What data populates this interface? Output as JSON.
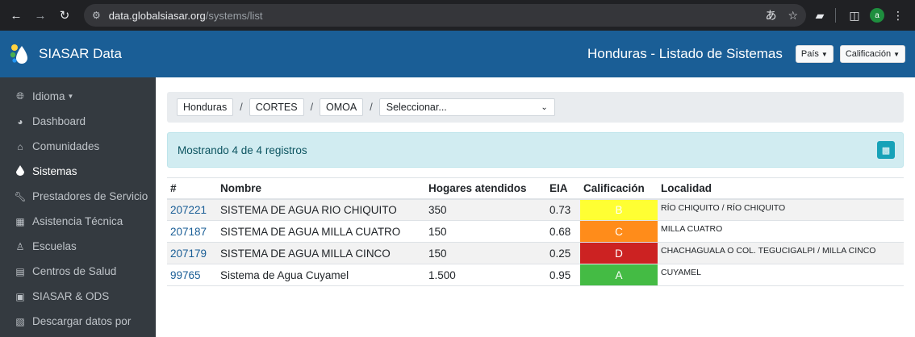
{
  "browser": {
    "host": "data.globalsiasar.org",
    "path": "/systems/list"
  },
  "header": {
    "brand": "SIASAR Data",
    "title": "Honduras - Listado de Sistemas",
    "country_btn": "País",
    "rating_btn": "Calificación"
  },
  "sidebar": {
    "items": [
      {
        "label": "Idioma",
        "icon": "globe-icon"
      },
      {
        "label": "Dashboard",
        "icon": "dashboard-icon"
      },
      {
        "label": "Comunidades",
        "icon": "home-icon"
      },
      {
        "label": "Sistemas",
        "icon": "water-drop-icon"
      },
      {
        "label": "Prestadores de Servicio",
        "icon": "wrench-icon"
      },
      {
        "label": "Asistencia Técnica",
        "icon": "clipboard-icon"
      },
      {
        "label": "Escuelas",
        "icon": "school-icon"
      },
      {
        "label": "Centros de Salud",
        "icon": "hospital-icon"
      },
      {
        "label": "SIASAR & ODS",
        "icon": "monitor-icon"
      },
      {
        "label": "Descargar datos por",
        "icon": "file-download-icon"
      }
    ]
  },
  "breadcrumb": {
    "country": "Honduras",
    "department": "CORTES",
    "municipality": "OMOA",
    "select_placeholder": "Seleccionar..."
  },
  "alert": {
    "text": "Mostrando 4 de 4 registros"
  },
  "table": {
    "headers": [
      "#",
      "Nombre",
      "Hogares atendidos",
      "EIA",
      "Calificación",
      "Localidad"
    ],
    "rows": [
      {
        "id": "207221",
        "name": "SISTEMA DE AGUA RIO CHIQUITO",
        "households": "350",
        "eia": "0.73",
        "grade": "B",
        "grade_color": "#ffff33",
        "location": "RÍO CHIQUITO / RÍO CHIQUITO"
      },
      {
        "id": "207187",
        "name": "SISTEMA DE AGUA MILLA CUATRO",
        "households": "150",
        "eia": "0.68",
        "grade": "C",
        "grade_color": "#ff8c1a",
        "location": "MILLA CUATRO"
      },
      {
        "id": "207179",
        "name": "SISTEMA DE AGUA MILLA CINCO",
        "households": "150",
        "eia": "0.25",
        "grade": "D",
        "grade_color": "#cc2222",
        "location": "CHACHAGUALA O COL. TEGUCIGALPI / MILLA CINCO"
      },
      {
        "id": "99765",
        "name": "Sistema de Agua Cuyamel",
        "households": "1.500",
        "eia": "0.95",
        "grade": "A",
        "grade_color": "#44bb44",
        "location": "CUYAMEL"
      }
    ]
  }
}
